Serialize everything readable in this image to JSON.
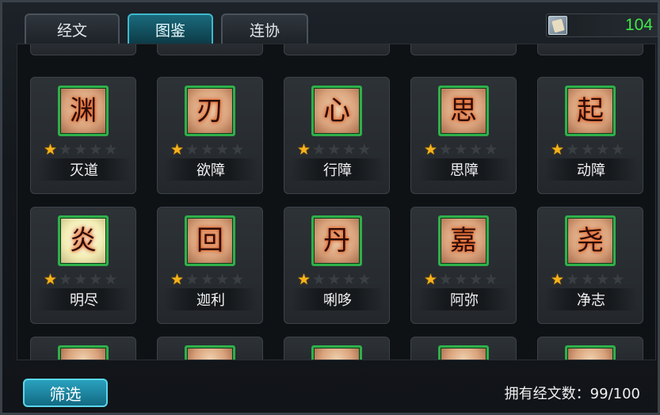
{
  "tabs": [
    {
      "label": "经文",
      "selected": false
    },
    {
      "label": "图鉴",
      "selected": true
    },
    {
      "label": "连协",
      "selected": false
    }
  ],
  "currency": {
    "icon": "scroll-icon",
    "value": "104"
  },
  "cards": [
    {
      "name": "灭道",
      "glyph": "渊",
      "stars": 1,
      "lit": false
    },
    {
      "name": "欲障",
      "glyph": "刃",
      "stars": 1,
      "lit": false
    },
    {
      "name": "行障",
      "glyph": "心",
      "stars": 1,
      "lit": false
    },
    {
      "name": "思障",
      "glyph": "思",
      "stars": 1,
      "lit": false
    },
    {
      "name": "动障",
      "glyph": "起",
      "stars": 1,
      "lit": false
    },
    {
      "name": "明尽",
      "glyph": "炎",
      "stars": 1,
      "lit": true
    },
    {
      "name": "迦利",
      "glyph": "回",
      "stars": 1,
      "lit": false
    },
    {
      "name": "唎哆",
      "glyph": "丹",
      "stars": 1,
      "lit": false
    },
    {
      "name": "阿弥",
      "glyph": "嘉",
      "stars": 1,
      "lit": false
    },
    {
      "name": "净志",
      "glyph": "尧",
      "stars": 1,
      "lit": false
    }
  ],
  "max_stars": 5,
  "filter_label": "筛选",
  "owned_text": "拥有经文数：99/100",
  "colors": {
    "accent": "#3fb8cc",
    "currency": "#3ee84a",
    "star": "#f6b21a",
    "emblem_border": "#2fb04a"
  }
}
